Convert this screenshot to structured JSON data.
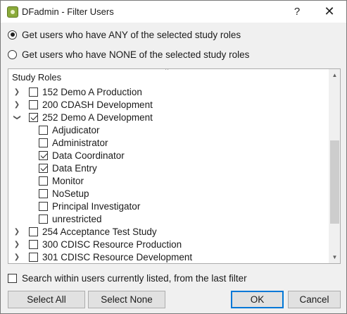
{
  "window": {
    "title": "DFadmin - Filter Users",
    "help_glyph": "?",
    "close_glyph": "✕"
  },
  "filter_mode": {
    "any_label": "Get users who have ANY of the selected study roles",
    "none_label": "Get users who have NONE of the selected study roles",
    "selected": "any"
  },
  "tree": {
    "header": "Study Roles",
    "sort_indicator": "^",
    "studies": [
      {
        "label": "152 Demo A Production",
        "checked": false,
        "expanded": false
      },
      {
        "label": "200 CDASH Development",
        "checked": false,
        "expanded": false
      },
      {
        "label": "252 Demo A Development",
        "checked": true,
        "expanded": true,
        "roles": [
          {
            "label": "Adjudicator",
            "checked": false
          },
          {
            "label": "Administrator",
            "checked": false
          },
          {
            "label": "Data Coordinator",
            "checked": true
          },
          {
            "label": "Data Entry",
            "checked": true
          },
          {
            "label": "Monitor",
            "checked": false
          },
          {
            "label": "NoSetup",
            "checked": false
          },
          {
            "label": "Principal Investigator",
            "checked": false
          },
          {
            "label": "unrestricted",
            "checked": false
          }
        ]
      },
      {
        "label": "254 Acceptance Test Study",
        "checked": false,
        "expanded": false
      },
      {
        "label": "300 CDISC Resource Production",
        "checked": false,
        "expanded": false
      },
      {
        "label": "301 CDISC Resource Development",
        "checked": false,
        "expanded": false
      }
    ]
  },
  "search_within": {
    "label": "Search within users currently listed, from the last filter",
    "checked": false
  },
  "buttons": {
    "select_all": "Select All",
    "select_none": "Select None",
    "ok": "OK",
    "cancel": "Cancel"
  }
}
